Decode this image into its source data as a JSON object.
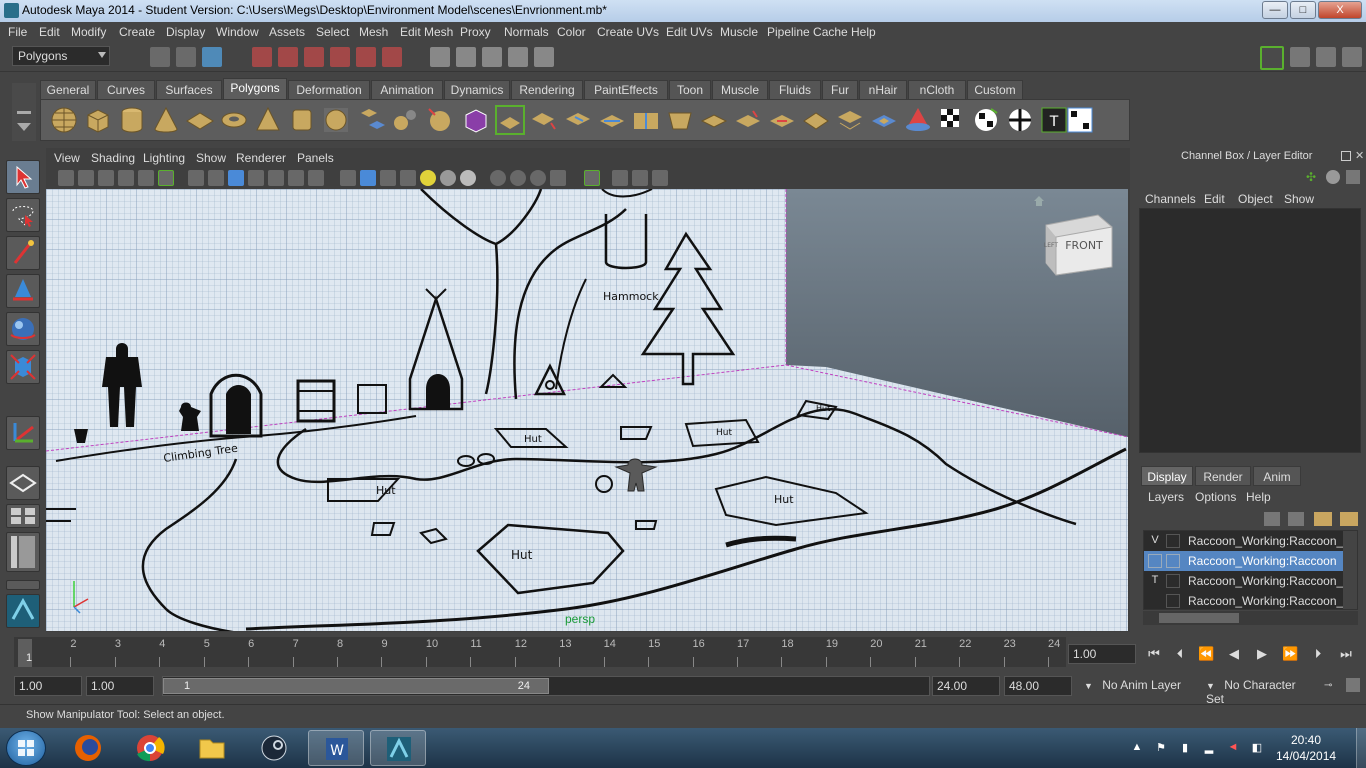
{
  "window": {
    "title": "Autodesk Maya 2014 - Student Version: C:\\Users\\Megs\\Desktop\\Environment Model\\scenes\\Envrionment.mb*",
    "minimize": "—",
    "maximize": "□",
    "close": "X"
  },
  "menubar": [
    "File",
    "Edit",
    "Modify",
    "Create",
    "Display",
    "Window",
    "Assets",
    "Select",
    "Mesh",
    "Edit Mesh",
    "Proxy",
    "Normals",
    "Color",
    "Create UVs",
    "Edit UVs",
    "Muscle",
    "Pipeline Cache",
    "Help"
  ],
  "statusline": {
    "mode": "Polygons"
  },
  "shelf": {
    "tabs": [
      "General",
      "Curves",
      "Surfaces",
      "Polygons",
      "Deformation",
      "Animation",
      "Dynamics",
      "Rendering",
      "PaintEffects",
      "Toon",
      "Muscle",
      "Fluids",
      "Fur",
      "nHair",
      "nCloth",
      "Custom"
    ],
    "active_tab": "Polygons"
  },
  "viewport": {
    "menus": [
      "View",
      "Shading",
      "Lighting",
      "Show",
      "Renderer",
      "Panels"
    ],
    "camera_label": "persp",
    "view_cube_label": "FRONT",
    "view_cube_side": "LEFT",
    "drawing_labels": [
      "Hammock",
      "Climbing Tree",
      "Hut",
      "Hut",
      "Hut",
      "Hut",
      "Hut",
      "Hut"
    ]
  },
  "channel_box": {
    "title": "Channel Box / Layer Editor",
    "menus": [
      "Channels",
      "Edit",
      "Object",
      "Show"
    ],
    "layer_tabs": [
      "Display",
      "Render",
      "Anim"
    ],
    "active_layer_tab": "Display",
    "layer_menus": [
      "Layers",
      "Options",
      "Help"
    ],
    "layers": [
      {
        "vis": "V",
        "name": "Raccoon_Working:Raccoon_Try",
        "selected": false
      },
      {
        "vis": "",
        "name": "Raccoon_Working:Raccoon",
        "selected": true
      },
      {
        "vis": "T",
        "name": "Raccoon_Working:Raccoon_Try",
        "selected": false
      },
      {
        "vis": "",
        "name": "Raccoon_Working:Raccoon_Try",
        "selected": false
      }
    ]
  },
  "timeline": {
    "ticks": [
      "1",
      "2",
      "3",
      "4",
      "5",
      "6",
      "7",
      "8",
      "9",
      "10",
      "11",
      "12",
      "13",
      "14",
      "15",
      "16",
      "17",
      "18",
      "19",
      "20",
      "21",
      "22",
      "23",
      "24"
    ],
    "current_frame_marker": "1",
    "current_time": "1.00"
  },
  "range": {
    "start_time": "1.00",
    "playback_start": "1.00",
    "range_start_label": "1",
    "range_end_label": "24",
    "playback_end": "24.00",
    "end_time": "48.00",
    "anim_layer": "No Anim Layer",
    "character_set": "No Character Set"
  },
  "helpline": "Show Manipulator Tool: Select an object.",
  "taskbar": {
    "time": "20:40",
    "date": "14/04/2014"
  }
}
